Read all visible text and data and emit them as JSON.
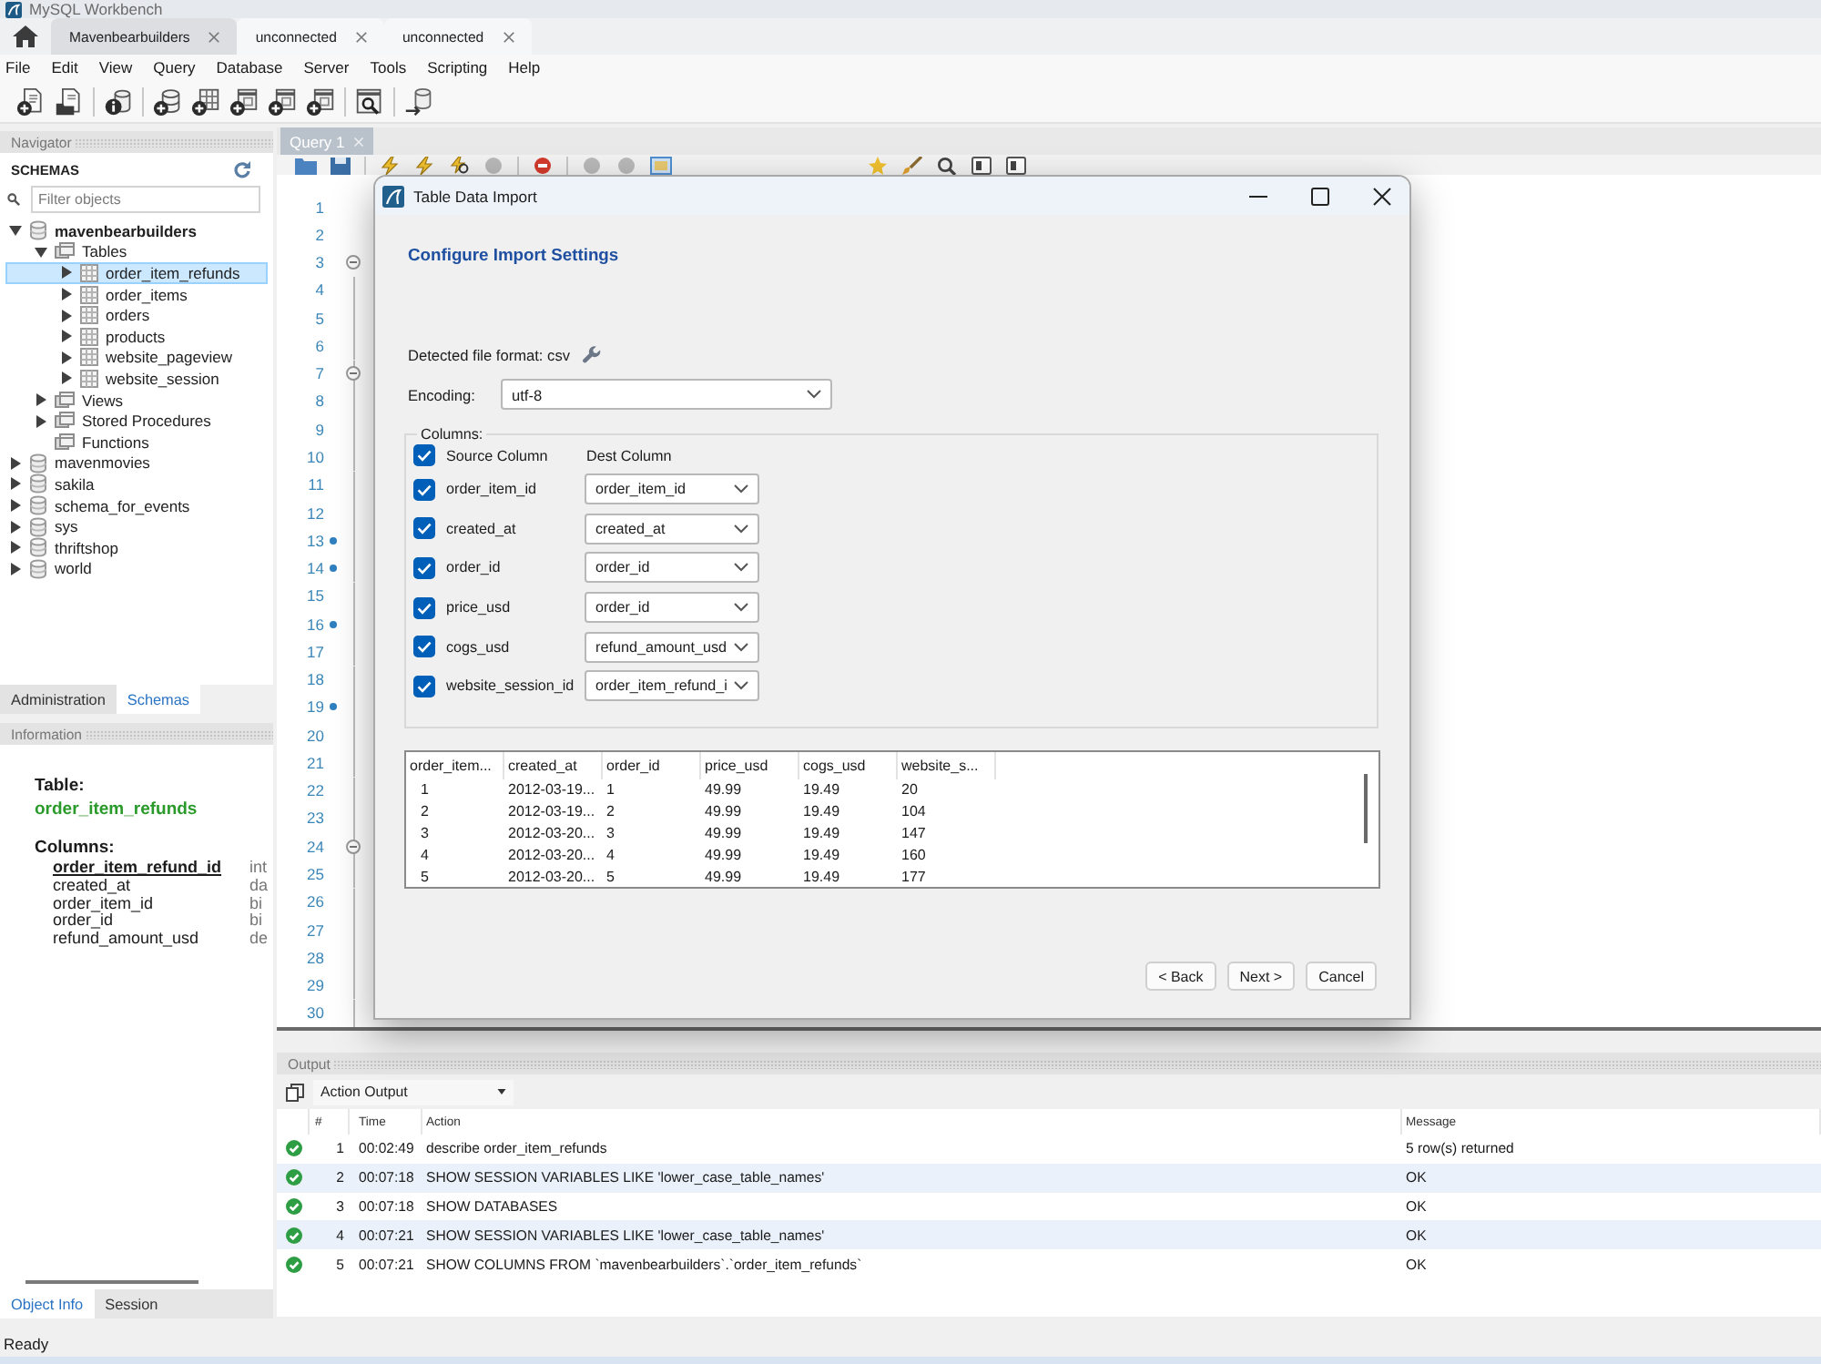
{
  "window": {
    "title": "MySQL Workbench"
  },
  "tabs": [
    {
      "label": "Mavenbearbuilders",
      "selected": true
    },
    {
      "label": "unconnected",
      "selected": false
    },
    {
      "label": "unconnected",
      "selected": false
    }
  ],
  "menu": [
    "File",
    "Edit",
    "View",
    "Query",
    "Database",
    "Server",
    "Tools",
    "Scripting",
    "Help"
  ],
  "navigator": {
    "title": "Navigator",
    "schemas_title": "SCHEMAS",
    "filter": {
      "placeholder": "Filter objects"
    },
    "tree": [
      {
        "label": "mavenbearbuilders",
        "kind": "schema",
        "default": true,
        "expandable": true,
        "expanded": true,
        "selected": false,
        "children": [
          {
            "label": "Tables",
            "kind": "folder",
            "expandable": true,
            "expanded": true,
            "selected": false,
            "children": [
              {
                "label": "order_item_refunds",
                "kind": "table",
                "expandable": true,
                "expanded": false,
                "selected": true
              },
              {
                "label": "order_items",
                "kind": "table",
                "expandable": true,
                "expanded": false,
                "selected": false
              },
              {
                "label": "orders",
                "kind": "table",
                "expandable": true,
                "expanded": false,
                "selected": false
              },
              {
                "label": "products",
                "kind": "table",
                "expandable": true,
                "expanded": false,
                "selected": false
              },
              {
                "label": "website_pageview",
                "kind": "table",
                "expandable": true,
                "expanded": false,
                "selected": false
              },
              {
                "label": "website_session",
                "kind": "table",
                "expandable": true,
                "expanded": false,
                "selected": false
              }
            ]
          },
          {
            "label": "Views",
            "kind": "folder",
            "expandable": true,
            "expanded": false,
            "selected": false
          },
          {
            "label": "Stored Procedures",
            "kind": "folder",
            "expandable": true,
            "expanded": false,
            "selected": false
          },
          {
            "label": "Functions",
            "kind": "folder",
            "expandable": false,
            "expanded": false,
            "selected": false
          }
        ]
      },
      {
        "label": "mavenmovies",
        "kind": "schema",
        "default": false,
        "expandable": true,
        "expanded": false,
        "selected": false
      },
      {
        "label": "sakila",
        "kind": "schema",
        "default": false,
        "expandable": true,
        "expanded": false,
        "selected": false
      },
      {
        "label": "schema_for_events",
        "kind": "schema",
        "default": false,
        "expandable": true,
        "expanded": false,
        "selected": false
      },
      {
        "label": "sys",
        "kind": "schema",
        "default": false,
        "expandable": true,
        "expanded": false,
        "selected": false
      },
      {
        "label": "thriftshop",
        "kind": "schema",
        "default": false,
        "expandable": true,
        "expanded": false,
        "selected": false
      },
      {
        "label": "world",
        "kind": "schema",
        "default": false,
        "expandable": true,
        "expanded": false,
        "selected": false
      }
    ],
    "tabs": [
      {
        "label": "Administration",
        "selected": false
      },
      {
        "label": "Schemas",
        "selected": true
      }
    ]
  },
  "information": {
    "title": "Information",
    "table_label": "Table:",
    "table_name": "order_item_refunds",
    "columns_label": "Columns:",
    "columns": [
      {
        "name": "order_item_refund_id",
        "type": "int",
        "primary_key": true
      },
      {
        "name": "created_at",
        "type": "da",
        "primary_key": false
      },
      {
        "name": "order_item_id",
        "type": "bi",
        "primary_key": false
      },
      {
        "name": "order_id",
        "type": "bi",
        "primary_key": false
      },
      {
        "name": "refund_amount_usd",
        "type": "de",
        "primary_key": false
      }
    ]
  },
  "bottom_tabs": [
    {
      "label": "Object Info",
      "selected": true
    },
    {
      "label": "Session",
      "selected": false
    }
  ],
  "editor": {
    "tab": "Query 1",
    "lines": [
      {
        "number": "1",
        "marker": false,
        "fold": false
      },
      {
        "number": "2",
        "marker": false,
        "fold": false
      },
      {
        "number": "3",
        "marker": false,
        "fold": true
      },
      {
        "number": "4",
        "marker": false,
        "fold": false
      },
      {
        "number": "5",
        "marker": false,
        "fold": false
      },
      {
        "number": "6",
        "marker": false,
        "fold": false
      },
      {
        "number": "7",
        "marker": false,
        "fold": true
      },
      {
        "number": "8",
        "marker": false,
        "fold": false
      },
      {
        "number": "9",
        "marker": false,
        "fold": false
      },
      {
        "number": "10",
        "marker": false,
        "fold": false
      },
      {
        "number": "11",
        "marker": false,
        "fold": false
      },
      {
        "number": "12",
        "marker": false,
        "fold": false
      },
      {
        "number": "13",
        "marker": true,
        "fold": false
      },
      {
        "number": "14",
        "marker": true,
        "fold": false
      },
      {
        "number": "15",
        "marker": false,
        "fold": false
      },
      {
        "number": "16",
        "marker": true,
        "fold": false
      },
      {
        "number": "17",
        "marker": false,
        "fold": false
      },
      {
        "number": "18",
        "marker": false,
        "fold": false
      },
      {
        "number": "19",
        "marker": true,
        "fold": false
      },
      {
        "number": "20",
        "marker": false,
        "fold": false
      },
      {
        "number": "21",
        "marker": false,
        "fold": false
      },
      {
        "number": "22",
        "marker": false,
        "fold": false
      },
      {
        "number": "23",
        "marker": false,
        "fold": false
      },
      {
        "number": "24",
        "marker": false,
        "fold": true
      },
      {
        "number": "25",
        "marker": false,
        "fold": false
      },
      {
        "number": "26",
        "marker": false,
        "fold": false
      },
      {
        "number": "27",
        "marker": false,
        "fold": false
      },
      {
        "number": "28",
        "marker": false,
        "fold": false
      },
      {
        "number": "29",
        "marker": false,
        "fold": false
      },
      {
        "number": "30",
        "marker": false,
        "fold": false
      }
    ]
  },
  "dialog": {
    "title": "Table Data Import",
    "heading": "Configure Import Settings",
    "file_format": "Detected file format: csv",
    "encoding": {
      "label": "Encoding:",
      "value": "utf-8"
    },
    "columns": {
      "label": "Columns:",
      "all_checked": true,
      "headers": [
        "Source Column",
        "Dest Column"
      ],
      "rows": [
        {
          "checked": true,
          "source": "order_item_id",
          "dest": "order_item_id"
        },
        {
          "checked": true,
          "source": "created_at",
          "dest": "created_at"
        },
        {
          "checked": true,
          "source": "order_id",
          "dest": "order_id"
        },
        {
          "checked": true,
          "source": "price_usd",
          "dest": "order_id"
        },
        {
          "checked": true,
          "source": "cogs_usd",
          "dest": "refund_amount_usd"
        },
        {
          "checked": true,
          "source": "website_session_id",
          "dest": "order_item_refund_i"
        }
      ]
    },
    "preview": {
      "columns": [
        "order_item...",
        "created_at",
        "order_id",
        "price_usd",
        "cogs_usd",
        "website_s..."
      ],
      "rows": [
        [
          "1",
          "2012-03-19...",
          "1",
          "49.99",
          "19.49",
          "20"
        ],
        [
          "2",
          "2012-03-19...",
          "2",
          "49.99",
          "19.49",
          "104"
        ],
        [
          "3",
          "2012-03-20...",
          "3",
          "49.99",
          "19.49",
          "147"
        ],
        [
          "4",
          "2012-03-20...",
          "4",
          "49.99",
          "19.49",
          "160"
        ],
        [
          "5",
          "2012-03-20...",
          "5",
          "49.99",
          "19.49",
          "177"
        ]
      ]
    },
    "buttons": [
      "< Back",
      "Next >",
      "Cancel"
    ]
  },
  "output": {
    "title": "Output",
    "selector": "Action Output",
    "columns": [
      "#",
      "Time",
      "Action",
      "Message"
    ],
    "rows": [
      {
        "succeeded": true,
        "number": "1",
        "time": "00:02:49",
        "action": "describe order_item_refunds",
        "message": "5 row(s) returned"
      },
      {
        "succeeded": true,
        "number": "2",
        "time": "00:07:18",
        "action": "SHOW SESSION VARIABLES LIKE 'lower_case_table_names'",
        "message": "OK"
      },
      {
        "succeeded": true,
        "number": "3",
        "time": "00:07:18",
        "action": "SHOW DATABASES",
        "message": "OK"
      },
      {
        "succeeded": true,
        "number": "4",
        "time": "00:07:21",
        "action": "SHOW SESSION VARIABLES LIKE 'lower_case_table_names'",
        "message": "OK"
      },
      {
        "succeeded": true,
        "number": "5",
        "time": "00:07:21",
        "action": "SHOW COLUMNS FROM `mavenbearbuilders`.`order_item_refunds`",
        "message": "OK"
      }
    ]
  },
  "status_bar": {
    "text": "Ready"
  }
}
